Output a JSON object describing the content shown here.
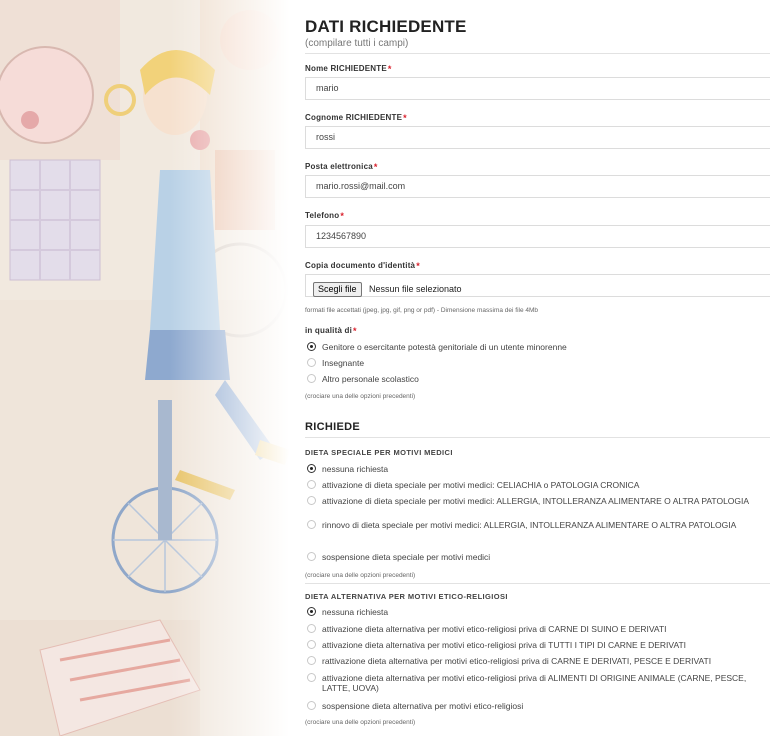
{
  "header": {
    "title": "DATI RICHIEDENTE",
    "subtitle": "(compilare tutti i campi)"
  },
  "fields": {
    "nome": {
      "label": "Nome RICHIEDENTE",
      "required": "*",
      "value": "mario"
    },
    "cognome": {
      "label": "Cognome RICHIEDENTE",
      "required": "*",
      "value": "rossi"
    },
    "email": {
      "label": "Posta elettronica",
      "required": "*",
      "value": "mario.rossi@mail.com"
    },
    "telefono": {
      "label": "Telefono",
      "required": "*",
      "value": "1234567890"
    },
    "documento": {
      "label": "Copia documento d'identità",
      "required": "*",
      "button_label": "Scegli file",
      "status": "Nessun file selezionato",
      "note": "formati file accettati (jpeg, jpg, gif, png or pdf) - Dimensione massima dei file 4Mb"
    }
  },
  "qualita": {
    "label": "in qualità di",
    "required": "*",
    "options": [
      {
        "label": "Genitore o esercitante potestà genitoriale di un utente minorenne",
        "checked": true
      },
      {
        "label": "Insegnante",
        "checked": false
      },
      {
        "label": "Altro personale scolastico",
        "checked": false
      }
    ],
    "note": "(crociare una delle opzioni precedenti)"
  },
  "richiede": {
    "title": "RICHIEDE",
    "dieta_medica": {
      "title": "DIETA SPECIALE PER MOTIVI MEDICI",
      "options": [
        {
          "label": "nessuna richiesta",
          "checked": true
        },
        {
          "label": "attivazione di dieta speciale per motivi medici: CELIACHIA o PATOLOGIA CRONICA",
          "checked": false
        },
        {
          "label": "attivazione di dieta speciale per motivi medici: ALLERGIA, INTOLLERANZA ALIMENTARE O ALTRA PATOLOGIA",
          "checked": false
        },
        {
          "label": "rinnovo di dieta speciale per motivi medici: ALLERGIA, INTOLLERANZA ALIMENTARE O ALTRA PATOLOGIA",
          "checked": false
        },
        {
          "label": "sospensione dieta speciale per motivi medici",
          "checked": false
        }
      ],
      "note": "(crociare una delle opzioni precedenti)"
    },
    "dieta_etica": {
      "title": "DIETA ALTERNATIVA PER MOTIVI ETICO-RELIGIOSI",
      "options": [
        {
          "label": "nessuna richiesta",
          "checked": true
        },
        {
          "label": "attivazione dieta alternativa per motivi etico-religiosi priva di CARNE DI SUINO E DERIVATI",
          "checked": false
        },
        {
          "label": "attivazione dieta alternativa per motivi etico-religiosi priva di TUTTI I TIPI DI CARNE E DERIVATI",
          "checked": false
        },
        {
          "label": "rattivazione dieta alternativa per motivi etico-religiosi priva di CARNE E DERIVATI, PESCE E DERIVATI",
          "checked": false
        },
        {
          "label": "attivazione dieta alternativa per motivi etico-religiosi priva di ALIMENTI DI ORIGINE ANIMALE (CARNE, PESCE, LATTE, UOVA)",
          "checked": false
        },
        {
          "label": "sospensione dieta alternativa per motivi etico-religiosi",
          "checked": false
        }
      ],
      "note": "(crociare una delle opzioni precedenti)"
    }
  }
}
